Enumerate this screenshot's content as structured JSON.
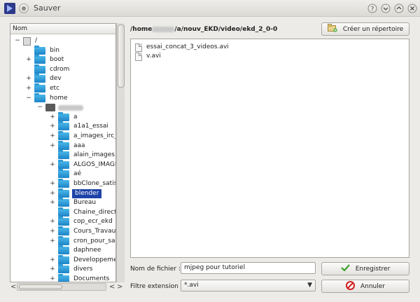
{
  "window": {
    "title": "Sauver"
  },
  "tree": {
    "header": "Nom",
    "root_label": "/",
    "items": [
      {
        "label": "bin",
        "expander": ""
      },
      {
        "label": "boot",
        "expander": "+"
      },
      {
        "label": "cdrom",
        "expander": ""
      },
      {
        "label": "dev",
        "expander": "+"
      },
      {
        "label": "etc",
        "expander": "+"
      },
      {
        "label": "home",
        "expander": "−"
      }
    ],
    "home_user_label": "",
    "subitems": [
      {
        "label": "a",
        "expander": "+",
        "selected": false
      },
      {
        "label": "a1a1_essai",
        "expander": "+",
        "selected": false
      },
      {
        "label": "a_images_irc_c",
        "expander": "+",
        "selected": false
      },
      {
        "label": "aaa",
        "expander": "+",
        "selected": false
      },
      {
        "label": "alain_images",
        "expander": "",
        "selected": false
      },
      {
        "label": "ALGOS_IMAGI",
        "expander": "+",
        "selected": false
      },
      {
        "label": "aé",
        "expander": "",
        "selected": false
      },
      {
        "label": "bbClone_satist",
        "expander": "+",
        "selected": false
      },
      {
        "label": "blender",
        "expander": "+",
        "selected": true
      },
      {
        "label": "Bureau",
        "expander": "+",
        "selected": false
      },
      {
        "label": "Chaine_direct_",
        "expander": "",
        "selected": false
      },
      {
        "label": "cop_ecr_ekd",
        "expander": "+",
        "selected": false
      },
      {
        "label": "Cours_Travaux",
        "expander": "+",
        "selected": false
      },
      {
        "label": "cron_pour_sau",
        "expander": "+",
        "selected": false
      },
      {
        "label": "daphnee",
        "expander": "",
        "selected": false
      },
      {
        "label": "Developpemen",
        "expander": "+",
        "selected": false
      },
      {
        "label": "divers",
        "expander": "+",
        "selected": false
      },
      {
        "label": "Documents",
        "expander": "+",
        "selected": false
      }
    ],
    "scroll_left": "<",
    "scroll_right_1": "<",
    "scroll_right_2": ">"
  },
  "path": {
    "prefix": "/home",
    "suffix": "/a/nouv_EKD/video/ekd_2_0-0"
  },
  "new_folder_button": "Créer un répertoire",
  "files": [
    "essai_concat_3_videos.avi",
    "v.avi"
  ],
  "filename": {
    "label": "Nom de fichier :",
    "value": "mjpeg pour tutoriel"
  },
  "filter": {
    "label": "Filtre extension :",
    "value": "*.avi"
  },
  "save_button": "Enregistrer",
  "cancel_button": "Annuler",
  "colors": {
    "selection": "#1e43a8",
    "folder": "#1d84c8",
    "ok_icon": "#3aa02a",
    "cancel_icon": "#d01f1f"
  }
}
